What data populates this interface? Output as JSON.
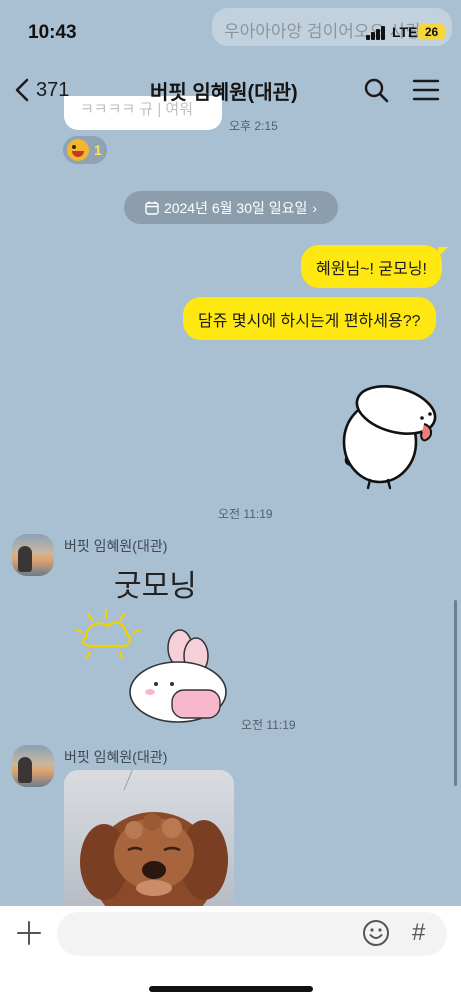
{
  "status_bar": {
    "time": "10:43",
    "network": "LTE",
    "battery": "26"
  },
  "background_preview": {
    "ghost_message": "우아아아앙 검이어오오 사랑"
  },
  "header": {
    "back_count": "371",
    "title": "버핏 임혜원(대관)"
  },
  "previous": {
    "bubble_text": "ㅋㅋㅋㅋ 규 | 여워",
    "time": "오후 2:15",
    "reaction_count": "1"
  },
  "date_divider": {
    "label": "2024년 6월 30일 일요일",
    "arrow": "›"
  },
  "messages": [
    {
      "side": "me",
      "text": "혜원님~! 굳모닝!"
    },
    {
      "side": "me",
      "text": "담쥬 몇시에 하시는게 편하세용??"
    },
    {
      "side": "me",
      "type": "sticker",
      "time": "오전 11:19"
    },
    {
      "side": "other",
      "sender": "버핏 임혜원(대관)",
      "type": "sticker",
      "sticker_text": "굿모닝",
      "time": "오전 11:19"
    },
    {
      "side": "other",
      "sender": "버핏 임혜원(대관)",
      "type": "photo"
    }
  ],
  "input": {
    "placeholder": "",
    "hash": "#"
  },
  "icons": {
    "back": "chevron-left-icon",
    "search": "search-icon",
    "menu": "hamburger-menu-icon",
    "calendar": "calendar-icon",
    "plus": "plus-icon",
    "emoji": "smiley-icon"
  },
  "colors": {
    "background": "#a9bfd2",
    "my_bubble": "#ffe812",
    "date_pill": "#8c9eae"
  }
}
